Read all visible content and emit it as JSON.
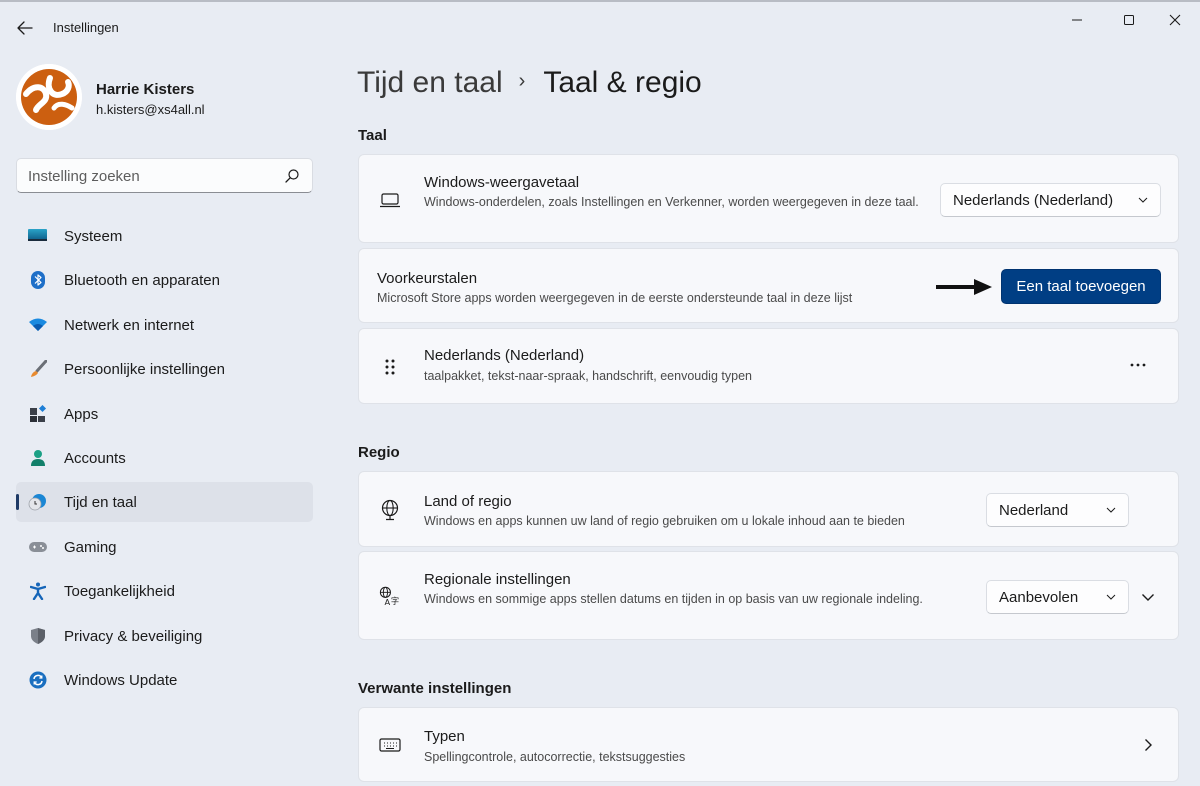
{
  "window": {
    "title": "Instellingen",
    "controls": {
      "minimize": "minimize",
      "maximize": "maximize",
      "close": "close"
    }
  },
  "profile": {
    "name": "Harrie Kisters",
    "email": "h.kisters@xs4all.nl"
  },
  "search": {
    "placeholder": "Instelling zoeken",
    "value": ""
  },
  "sidebar": {
    "items": [
      {
        "label": "Systeem",
        "icon": "system-icon",
        "active": false
      },
      {
        "label": "Bluetooth en apparaten",
        "icon": "bluetooth-icon",
        "active": false
      },
      {
        "label": "Netwerk en internet",
        "icon": "wifi-icon",
        "active": false
      },
      {
        "label": "Persoonlijke instellingen",
        "icon": "paintbrush-icon",
        "active": false
      },
      {
        "label": "Apps",
        "icon": "apps-icon",
        "active": false
      },
      {
        "label": "Accounts",
        "icon": "account-icon",
        "active": false
      },
      {
        "label": "Tijd en taal",
        "icon": "time-language-icon",
        "active": true
      },
      {
        "label": "Gaming",
        "icon": "gamepad-icon",
        "active": false
      },
      {
        "label": "Toegankelijkheid",
        "icon": "accessibility-icon",
        "active": false
      },
      {
        "label": "Privacy & beveiliging",
        "icon": "shield-icon",
        "active": false
      },
      {
        "label": "Windows Update",
        "icon": "update-icon",
        "active": false
      }
    ]
  },
  "breadcrumb": {
    "parent": "Tijd en taal",
    "separator": "›",
    "current": "Taal & regio"
  },
  "sections": {
    "taal": {
      "title": "Taal",
      "display_language": {
        "title": "Windows-weergavetaal",
        "description": "Windows-onderdelen, zoals Instellingen en Verkenner, worden weergegeven in deze taal.",
        "selected": "Nederlands (Nederland)"
      },
      "preferred": {
        "title": "Voorkeurstalen",
        "description": "Microsoft Store apps worden weergegeven in de eerste ondersteunde taal in deze lijst",
        "button": "Een taal toevoegen"
      },
      "languages": [
        {
          "name": "Nederlands (Nederland)",
          "features": "taalpakket, tekst-naar-spraak, handschrift, eenvoudig typen"
        }
      ]
    },
    "regio": {
      "title": "Regio",
      "country": {
        "title": "Land of regio",
        "description": "Windows en apps kunnen uw land of regio gebruiken om u lokale inhoud aan te bieden",
        "selected": "Nederland"
      },
      "regional_format": {
        "title": "Regionale instellingen",
        "description": "Windows en sommige apps stellen datums en tijden in op basis van uw regionale indeling.",
        "selected": "Aanbevolen"
      }
    },
    "related": {
      "title": "Verwante instellingen",
      "typing": {
        "title": "Typen",
        "description": "Spellingcontrole, autocorrectie, tekstsuggesties"
      }
    }
  },
  "colors": {
    "accent": "#003e84",
    "background": "#e8ecf3",
    "card": "#f7f8fb",
    "nav_active": "#dde1e9"
  }
}
